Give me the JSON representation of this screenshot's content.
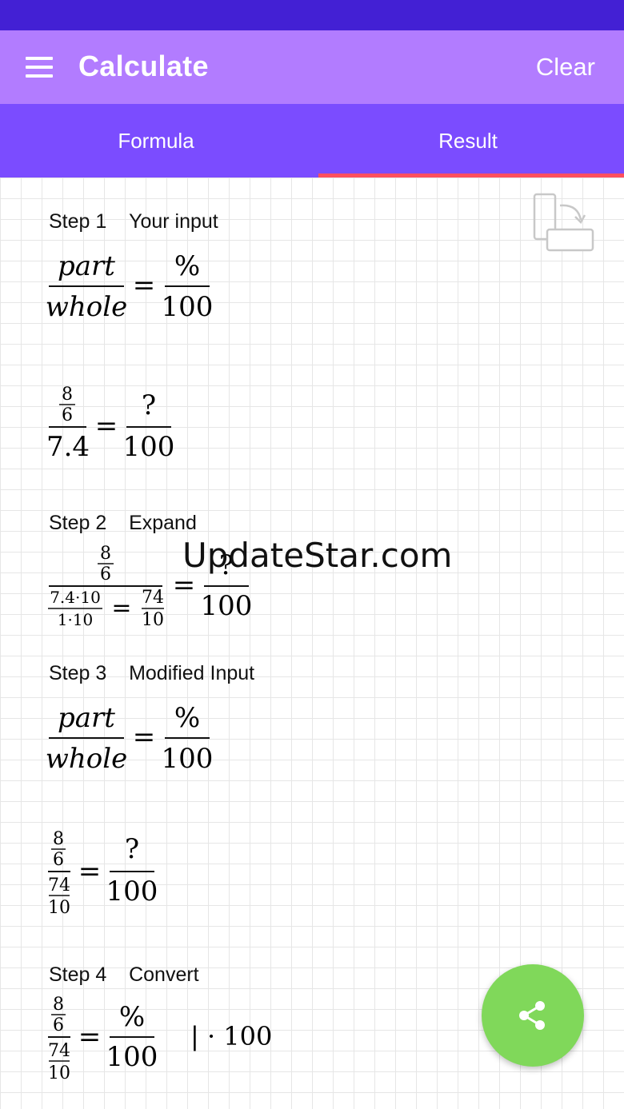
{
  "app": {
    "title": "Calculate",
    "clear_label": "Clear",
    "colors": {
      "status_bar": "#4320d4",
      "app_bar": "#b27cff",
      "tabs_bar": "#7b4cff",
      "tab_indicator": "#ff4f5e",
      "fab": "#80d85a"
    }
  },
  "tabs": [
    {
      "label": "Formula",
      "active": false
    },
    {
      "label": "Result",
      "active": true
    }
  ],
  "steps": [
    {
      "number": "Step 1",
      "title": "Your input"
    },
    {
      "number": "Step 2",
      "title": "Expand"
    },
    {
      "number": "Step 3",
      "title": "Modified Input"
    },
    {
      "number": "Step 4",
      "title": "Convert"
    }
  ],
  "math": {
    "part": "part",
    "whole": "whole",
    "percent": "%",
    "hundred": "100",
    "question": "?",
    "eight": "8",
    "six": "6",
    "seven_point_four": "7.4",
    "seven_point_four_times_ten": "7.4·10",
    "one_times_ten": "1·10",
    "seventy_four": "74",
    "ten": "10",
    "equals": "=",
    "bar_times_100": "| · 100"
  },
  "watermark": "UpdateStar.com",
  "icons": {
    "menu": "hamburger-menu-icon",
    "rotate": "rotate-device-icon",
    "share": "share-icon"
  }
}
